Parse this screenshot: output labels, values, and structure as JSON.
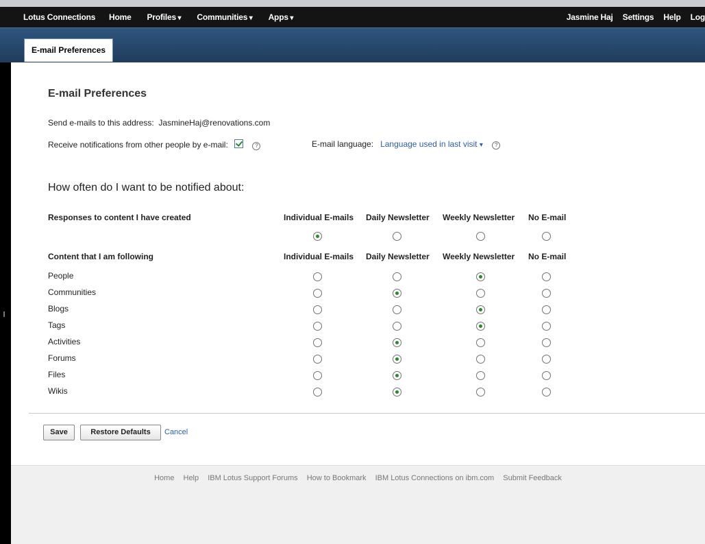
{
  "topnav": {
    "brand": "Lotus Connections",
    "items": [
      "Home",
      "Profiles",
      "Communities",
      "Apps"
    ],
    "dropdown_flags": [
      false,
      true,
      true,
      true
    ],
    "right": [
      "Jasmine Haj",
      "Settings",
      "Help",
      "Log"
    ]
  },
  "tab": "E-mail Preferences",
  "title": "E-mail Preferences",
  "address_label": "Send e-mails to this address:",
  "address": "JasmineHaj@renovations.com",
  "notify_label": "Receive notifications from other people by e-mail:",
  "notify_checked": true,
  "language_label": "E-mail language:",
  "language_value": "Language used in last visit",
  "section_title": "How often do I want to be notified about:",
  "columns": [
    "Individual E-mails",
    "Daily Newsletter",
    "Weekly Newsletter",
    "No E-mail"
  ],
  "responses": {
    "label": "Responses to content I have created",
    "selected": 0
  },
  "following": {
    "label": "Content that I am following",
    "rows": [
      {
        "name": "People",
        "selected": 2
      },
      {
        "name": "Communities",
        "selected": 1
      },
      {
        "name": "Blogs",
        "selected": 2
      },
      {
        "name": "Tags",
        "selected": 2
      },
      {
        "name": "Activities",
        "selected": 1
      },
      {
        "name": "Forums",
        "selected": 1
      },
      {
        "name": "Files",
        "selected": 1
      },
      {
        "name": "Wikis",
        "selected": 1
      }
    ]
  },
  "buttons": {
    "save": "Save",
    "restore": "Restore Defaults",
    "cancel": "Cancel"
  },
  "footer_links": [
    "Home",
    "Help",
    "IBM Lotus Support Forums",
    "How to Bookmark",
    "IBM Lotus Connections on ibm.com",
    "Submit Feedback"
  ],
  "colors": {
    "nav_bg": "#141414",
    "subbar": "#2f557d",
    "link": "#2b5ea8",
    "radio_selected": "#2a8a2a"
  }
}
